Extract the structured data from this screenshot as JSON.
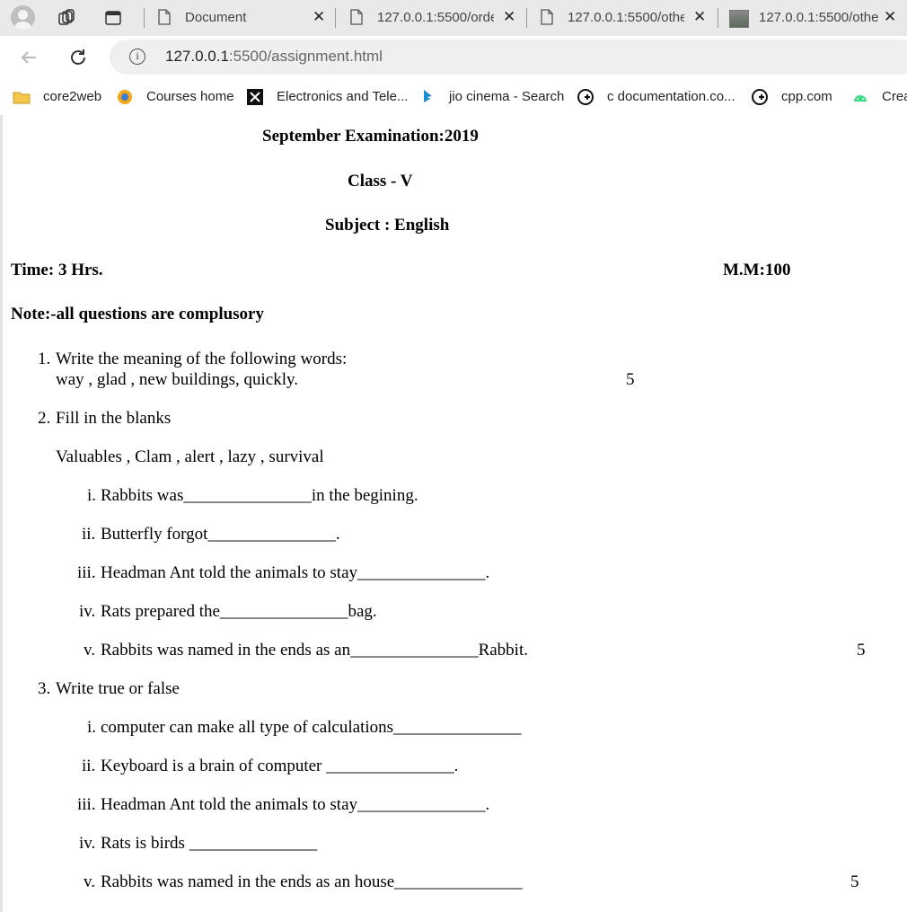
{
  "browser": {
    "tabs": [
      {
        "title": "Document",
        "active": false
      },
      {
        "title": "127.0.0.1:5500/orde",
        "active": false
      },
      {
        "title": "127.0.0.1:5500/othe",
        "active": false
      },
      {
        "title": "127.0.0.1:5500/othe",
        "active": false
      }
    ],
    "url_host": "127.0.0.1",
    "url_rest": ":5500/assignment.html",
    "bookmarks": [
      {
        "label": "core2web",
        "icon": "folder-icon"
      },
      {
        "label": "Courses home",
        "icon": "courses-icon"
      },
      {
        "label": "Electronics and Tele...",
        "icon": "electronics-icon"
      },
      {
        "label": "jio cinema - Search",
        "icon": "bing-icon"
      },
      {
        "label": "c documentation.co...",
        "icon": "cplusplus-icon"
      },
      {
        "label": "cpp.com",
        "icon": "cplusplus-icon"
      },
      {
        "label": "Crea",
        "icon": "android-icon"
      }
    ]
  },
  "exam": {
    "title": "September Examination:2019",
    "class": "Class - V",
    "subject": "Subject : English",
    "time": "Time: 3 Hrs.",
    "max_marks": "M.M:100",
    "note": "Note:-all questions are complusory",
    "q1": {
      "number": "1.",
      "text": "Write the meaning of the following words:",
      "words": "way , glad , new buildings, quickly.",
      "marks": "5"
    },
    "q2": {
      "number": "2.",
      "text": "Fill in the blanks",
      "options": "Valuables , Clam , alert , lazy , survival",
      "items": [
        {
          "num": "i.",
          "text": "Rabbits was_______________in the begining."
        },
        {
          "num": "ii.",
          "text": "Butterfly forgot_______________."
        },
        {
          "num": "iii.",
          "text": "Headman Ant told the animals to stay_______________."
        },
        {
          "num": "iv.",
          "text": "Rats prepared the_______________bag."
        },
        {
          "num": "v.",
          "text": "Rabbits was named in the ends as an_______________Rabbit."
        }
      ],
      "marks": "5"
    },
    "q3": {
      "number": "3.",
      "text": "Write true or false",
      "items": [
        {
          "num": "i.",
          "text": "computer can make all type of calculations_______________"
        },
        {
          "num": "ii.",
          "text": "Keyboard is a brain of computer _______________."
        },
        {
          "num": "iii.",
          "text": "Headman Ant told the animals to stay_______________."
        },
        {
          "num": "iv.",
          "text": "Rats is birds _______________"
        },
        {
          "num": "v.",
          "text": "Rabbits was named in the ends as an house_______________"
        }
      ],
      "marks": "5"
    }
  }
}
